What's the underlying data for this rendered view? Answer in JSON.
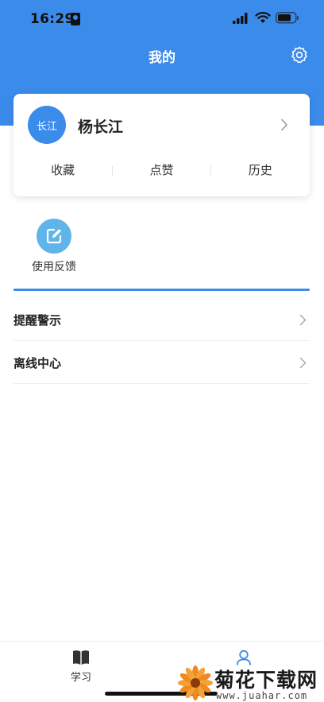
{
  "status_bar": {
    "time": "16:29"
  },
  "header": {
    "title": "我的"
  },
  "profile": {
    "avatar_text": "长江",
    "name": "杨长江",
    "stats": [
      {
        "label": "收藏"
      },
      {
        "label": "点赞"
      },
      {
        "label": "历史"
      }
    ]
  },
  "feedback": {
    "label": "使用反馈"
  },
  "menu": [
    {
      "label": "提醒警示"
    },
    {
      "label": "离线中心"
    }
  ],
  "tab_bar": {
    "tabs": [
      {
        "label": "学习",
        "icon": "book-icon"
      },
      {
        "label": "",
        "icon": "user-icon"
      }
    ]
  },
  "watermark": {
    "title": "菊花下载网",
    "url": "www.juahar.com"
  },
  "colors": {
    "primary": "#3b8beb",
    "feedback_icon": "#5fb4ea",
    "divider": "#eeeeee"
  }
}
